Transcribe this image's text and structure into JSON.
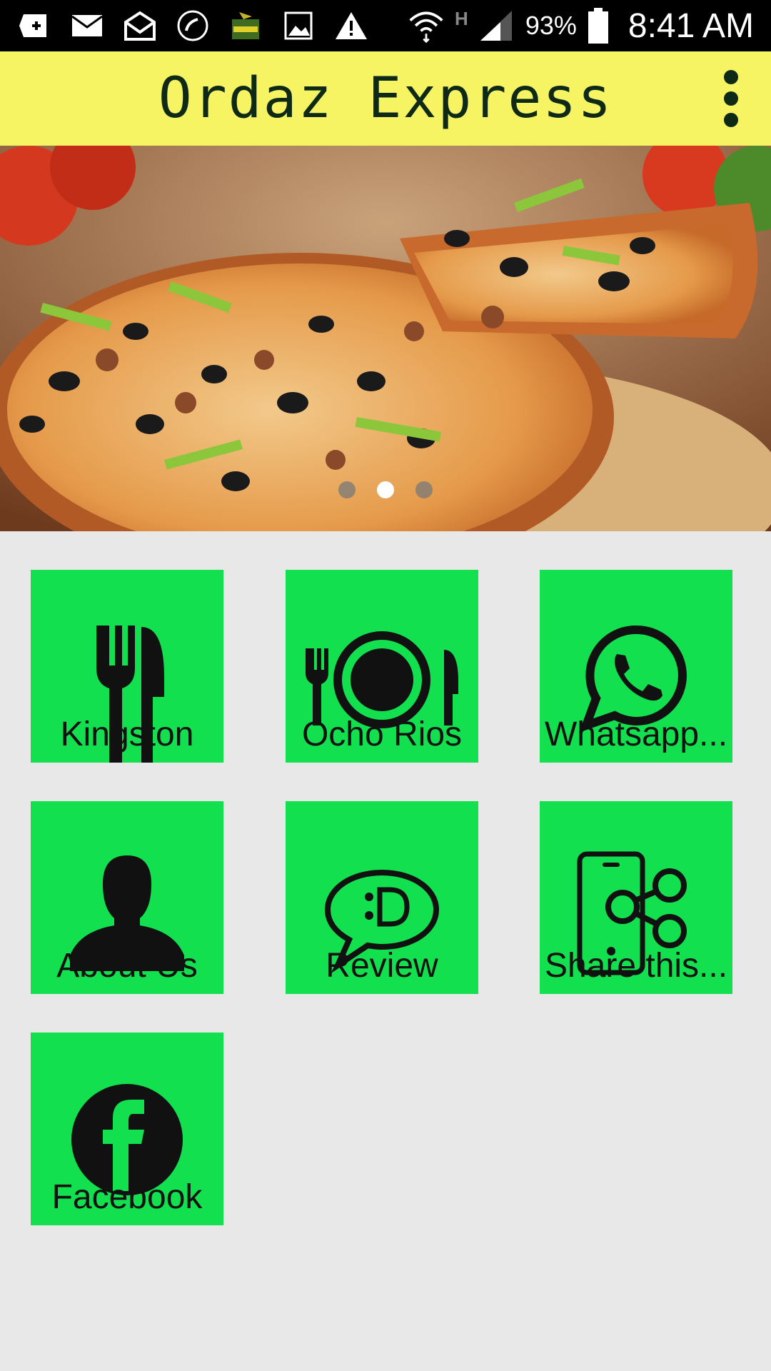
{
  "status_bar": {
    "battery_percent": "93%",
    "time": "8:41 AM",
    "network_type": "H",
    "icons": [
      "add-box-icon",
      "email-icon",
      "open-mail-icon",
      "phone-call-icon",
      "app-logo-icon",
      "image-icon",
      "warning-icon",
      "wifi-icon",
      "signal-icon",
      "battery-icon"
    ]
  },
  "app_bar": {
    "title": "Ordaz Express",
    "menu_icon": "overflow-menu-icon",
    "background": "#f6f462"
  },
  "banner": {
    "image": "pizza-photo",
    "pager_count": 3,
    "active_index": 1
  },
  "tiles": [
    {
      "label": "Kingston",
      "icon": "fork-knife-icon"
    },
    {
      "label": "Ocho Rios",
      "icon": "plate-cutlery-icon"
    },
    {
      "label": "Whatsapp...",
      "icon": "whatsapp-icon"
    },
    {
      "label": "About Us",
      "icon": "person-icon"
    },
    {
      "label": "Review",
      "icon": "chat-bubble-icon"
    },
    {
      "label": "Share this...",
      "icon": "share-phone-icon"
    },
    {
      "label": "Facebook",
      "icon": "facebook-icon"
    }
  ],
  "colors": {
    "tile": "#12e04e",
    "background": "#e8e8e8",
    "title_text": "#0e2a16"
  }
}
